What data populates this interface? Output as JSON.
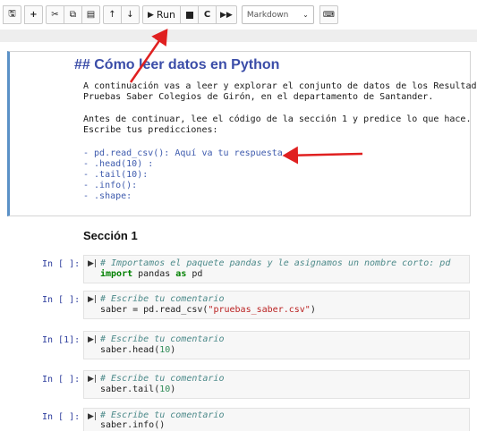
{
  "toolbar": {
    "run_label": "Run",
    "cell_type": "Markdown"
  },
  "markdown_cell": {
    "title": "## Cómo leer datos en Python",
    "paragraph1_line1": "A continuación vas a leer y explorar el conjunto de datos de los Resultados",
    "paragraph1_line2": "Pruebas Saber Colegios de Girón, en el departamento de Santander.",
    "paragraph2_line1": "Antes de continuar, lee el código de la sección 1 y predice lo que hace.",
    "paragraph2_line2": "Escribe tus predicciones:",
    "items": [
      "- pd.read_csv(): Aquí va tu respuesta",
      "- .head(10) :",
      "- .tail(10):",
      "- .info():",
      "- .shape:"
    ]
  },
  "section": {
    "title": "Sección 1"
  },
  "cells": [
    {
      "prompt": "In [ ]:",
      "comment": "# Importamos el paquete pandas y le asignamos un nombre corto: pd",
      "code_kw": "import",
      "code_rest1": " pandas ",
      "code_kw2": "as",
      "code_rest2": " pd"
    },
    {
      "prompt": "In [ ]:",
      "comment": "# Escribe tu comentario",
      "code_pre": "saber = pd.read_csv(",
      "code_str": "\"pruebas_saber.csv\"",
      "code_post": ")"
    },
    {
      "prompt": "In [1]:",
      "comment": "# Escribe tu comentario",
      "code_pre": "saber.head(",
      "code_num": "10",
      "code_post": ")"
    },
    {
      "prompt": "In [ ]:",
      "comment": "# Escribe tu comentario",
      "code_pre": "saber.tail(",
      "code_num": "10",
      "code_post": ")"
    },
    {
      "prompt": "In [ ]:",
      "comment": "# Escribe tu comentario",
      "code_pre": "saber.info()"
    }
  ],
  "colors": {
    "arrow": "#e02020",
    "title": "#3b4da8",
    "prompt": "#2f3f9e",
    "accent_border": "#5b91c7"
  }
}
